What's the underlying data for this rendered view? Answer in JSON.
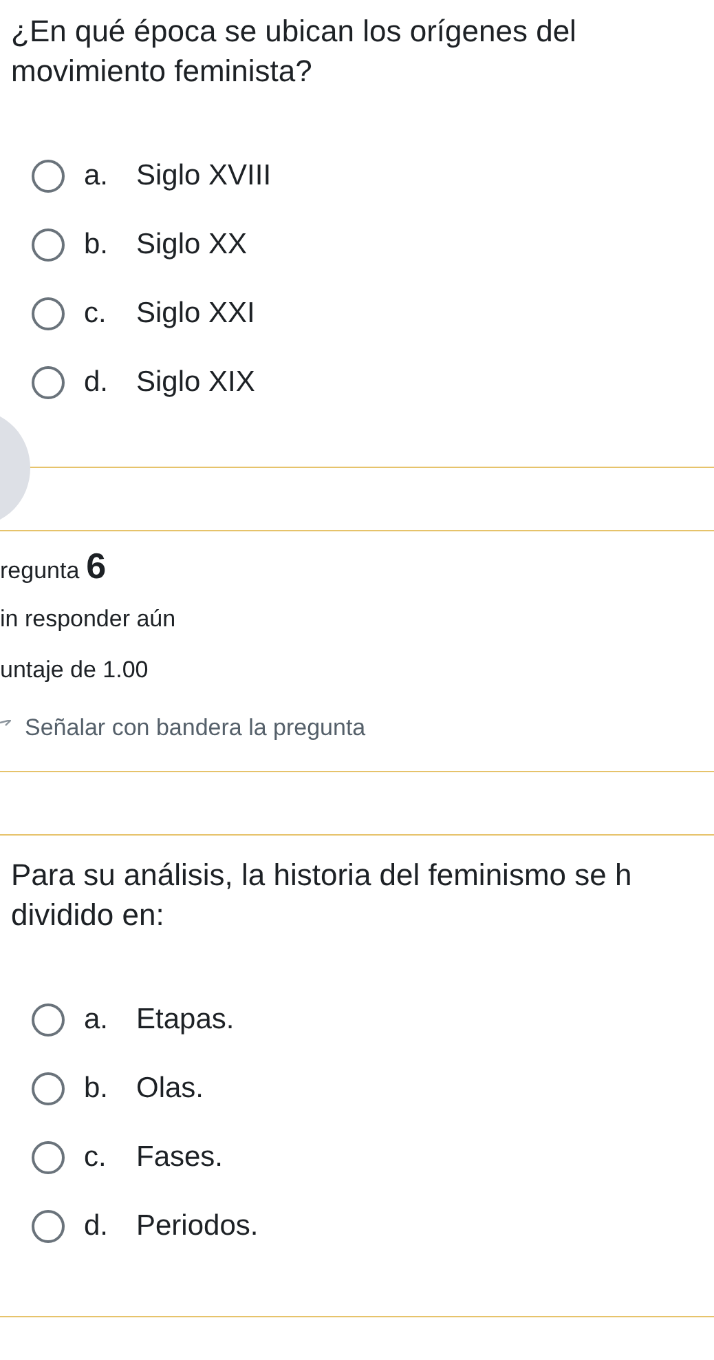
{
  "sections": [
    {
      "kind": "question",
      "text": "¿En qué época se ubican los orígenes del movimiento feminista?",
      "options": [
        {
          "letter": "a.",
          "text": "Siglo XVIII",
          "selected": false
        },
        {
          "letter": "b.",
          "text": "Siglo XX",
          "selected": false
        },
        {
          "letter": "c.",
          "text": "Siglo XXI",
          "selected": false
        },
        {
          "letter": "d.",
          "text": "Siglo XIX",
          "selected": false
        }
      ]
    },
    {
      "kind": "info",
      "label": "regunta",
      "number": "6",
      "status": "in responder aún",
      "score": "untaje de 1.00",
      "flag_label": "Señalar con bandera la pregunta"
    },
    {
      "kind": "question",
      "text": "Para su análisis, la historia del feminismo se h dividido en:",
      "options": [
        {
          "letter": "a.",
          "text": "Etapas.",
          "selected": false
        },
        {
          "letter": "b.",
          "text": "Olas.",
          "selected": false
        },
        {
          "letter": "c.",
          "text": "Fases.",
          "selected": false
        },
        {
          "letter": "d.",
          "text": "Periodos.",
          "selected": false
        }
      ]
    }
  ]
}
